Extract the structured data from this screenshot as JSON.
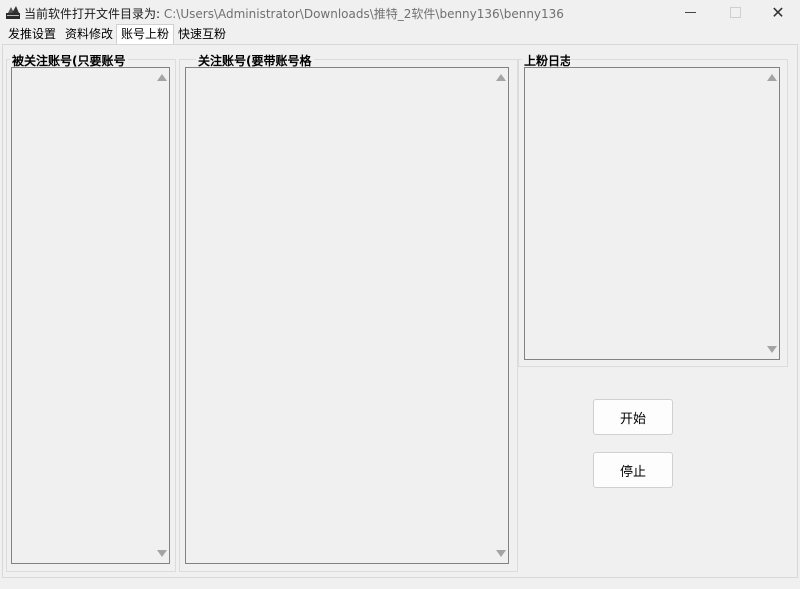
{
  "window": {
    "title_prefix": "当前软件打开文件目录为:",
    "title_path": "C:\\Users\\Administrator\\Downloads\\推特_2软件\\benny136\\benny136",
    "close_glyph": "✕"
  },
  "tabs": [
    {
      "label": "发推设置"
    },
    {
      "label": "资料修改"
    },
    {
      "label": "账号上粉",
      "active": true
    },
    {
      "label": "快速互粉"
    }
  ],
  "groups": {
    "followed": {
      "label": "被关注账号(只要账号"
    },
    "followers": {
      "label": "关注账号(要带账号格"
    },
    "log": {
      "label": "上粉日志"
    }
  },
  "buttons": {
    "start": "开始",
    "stop": "停止"
  }
}
